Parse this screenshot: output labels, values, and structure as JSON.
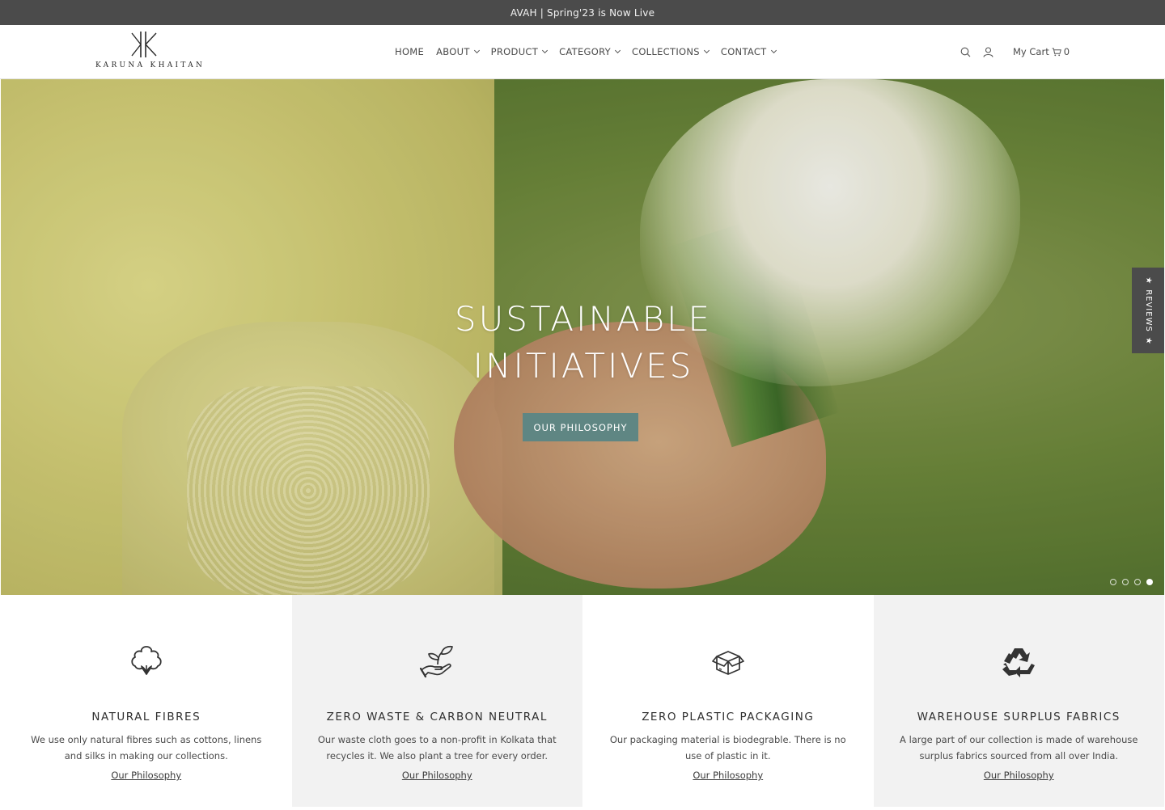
{
  "announcement": "AVAH | Spring'23 is Now Live",
  "logo": {
    "text": "KARUNA KHAITAN"
  },
  "nav": [
    {
      "label": "HOME",
      "dropdown": false
    },
    {
      "label": "ABOUT",
      "dropdown": true
    },
    {
      "label": "PRODUCT",
      "dropdown": true
    },
    {
      "label": "CATEGORY",
      "dropdown": true
    },
    {
      "label": "COLLECTIONS",
      "dropdown": true
    },
    {
      "label": "CONTACT",
      "dropdown": true
    }
  ],
  "utilities": {
    "search_icon": "search-icon",
    "account_icon": "user-icon",
    "cart_label": "My Cart",
    "cart_count": "0"
  },
  "hero": {
    "title_line1": "SUSTAINABLE",
    "title_line2": "INITIATIVES",
    "button_label": "OUR PHILOSOPHY",
    "slide_count": 4,
    "active_slide": 4
  },
  "reviews_tab": {
    "label": "REVIEWS"
  },
  "features": [
    {
      "icon": "cotton-icon",
      "title": "NATURAL FIBRES",
      "description": "We use only natural fibres such as cottons, linens and silks in making our collections.",
      "link": "Our Philosophy"
    },
    {
      "icon": "plant-hand-icon",
      "title": "ZERO WASTE & CARBON NEUTRAL",
      "description": "Our waste cloth goes to a non-profit in Kolkata that recycles it. We also plant a tree for every order.",
      "link": "Our Philosophy"
    },
    {
      "icon": "box-icon",
      "title": "ZERO PLASTIC PACKAGING",
      "description": "Our packaging material is biodegrable. There is no use of plastic in it.",
      "link": "Our Philosophy"
    },
    {
      "icon": "recycle-icon",
      "title": "WAREHOUSE SURPLUS FABRICS",
      "description": "A large part of our collection is made of warehouse surplus fabrics sourced from all over India.",
      "link": "Our Philosophy"
    }
  ],
  "colors": {
    "announcement_bg": "#4b4b4b",
    "hero_button_bg": "#5f8683",
    "feature_alt_bg": "#f2f2f2"
  }
}
